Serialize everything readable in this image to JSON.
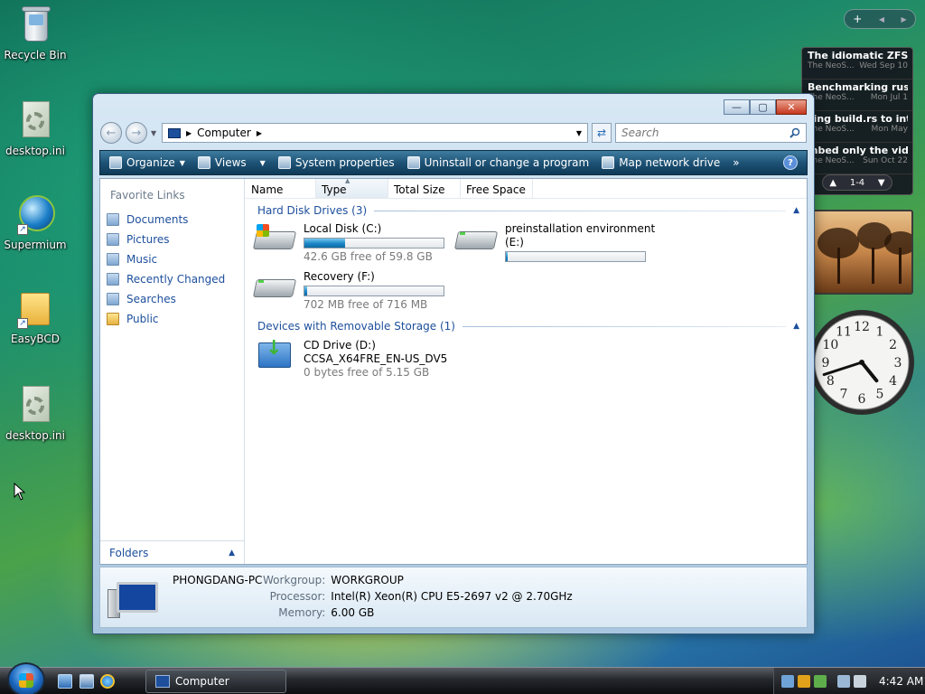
{
  "desktop": {
    "icons": [
      {
        "label": "Recycle Bin"
      },
      {
        "label": "desktop.ini"
      },
      {
        "label": "Supermium"
      },
      {
        "label": "EasyBCD"
      },
      {
        "label": "desktop.ini"
      }
    ]
  },
  "gadgets": {
    "controls": {
      "add": "+",
      "prev": "◀",
      "next": "▶"
    },
    "feed": {
      "items": [
        {
          "title": "The idiomatic ZFS on...",
          "source": "The NeoS...",
          "date": "Wed Sep 10"
        },
        {
          "title": "Benchmarking rust c...",
          "source": "The NeoS...",
          "date": "Mon Jul 1"
        },
        {
          "title": "sing build.rs to inte...",
          "source": "The NeoS...",
          "date": "Mon May"
        },
        {
          "title": "mbed only the vide...",
          "source": "The NeoS...",
          "date": "Sun Oct 22"
        }
      ],
      "pager": "1-4"
    },
    "clock": {
      "hour": 4,
      "minute": 42
    }
  },
  "window": {
    "controls": {
      "minimize": "—",
      "maximize": "▢",
      "close": "✕"
    },
    "address": {
      "segments": [
        "Computer"
      ]
    },
    "search": {
      "placeholder": "Search"
    },
    "toolbar": {
      "organize": "Organize",
      "views": "Views",
      "system_properties": "System properties",
      "uninstall": "Uninstall or change a program",
      "map_drive": "Map network drive",
      "more": "»",
      "help": "?"
    },
    "nav": {
      "heading": "Favorite Links",
      "links": [
        "Documents",
        "Pictures",
        "Music",
        "Recently Changed",
        "Searches",
        "Public"
      ],
      "folders": "Folders"
    },
    "columns": [
      "Name",
      "Type",
      "Total Size",
      "Free Space"
    ],
    "groups": {
      "hard_disks": {
        "title": "Hard Disk Drives (3)",
        "drives": [
          {
            "name": "Local Disk (C:)",
            "free_text": "42.6 GB free of 59.8 GB",
            "used_fraction": 0.29
          },
          {
            "name": "preinstallation environment",
            "name2": "(E:)",
            "used_fraction": 0.01
          },
          {
            "name": "Recovery (F:)",
            "free_text": "702 MB free of 716 MB",
            "used_fraction": 0.02
          }
        ]
      },
      "removable": {
        "title": "Devices with Removable Storage (1)",
        "drives": [
          {
            "name": "CD Drive (D:)",
            "label": "CCSA_X64FRE_EN-US_DV5",
            "free_text": "0 bytes free of 5.15 GB"
          }
        ]
      }
    },
    "details": {
      "computer_name": "PHONGDANG-PC",
      "workgroup_label": "Workgroup:",
      "workgroup": "WORKGROUP",
      "processor_label": "Processor:",
      "processor": "Intel(R) Xeon(R) CPU E5-2697 v2 @ 2.70GHz",
      "memory_label": "Memory:",
      "memory": "6.00 GB"
    }
  },
  "taskbar": {
    "active_window": "Computer",
    "time": "4:42 AM"
  },
  "colors": {
    "link_blue": "#1d4f9c",
    "toolbar_dark": "#1e5376",
    "bar_fill": "#1b86c7"
  }
}
